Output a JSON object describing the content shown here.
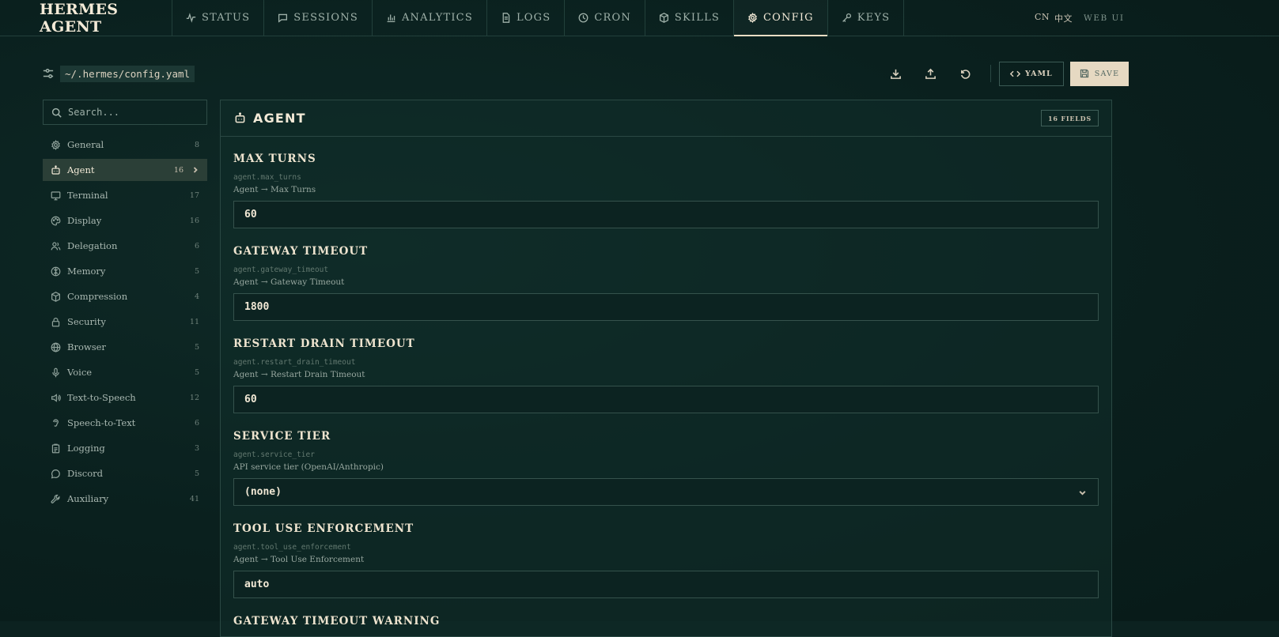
{
  "brand": "HERMES AGENT",
  "nav": [
    {
      "label": "STATUS",
      "icon": "activity-icon"
    },
    {
      "label": "SESSIONS",
      "icon": "chat-icon"
    },
    {
      "label": "ANALYTICS",
      "icon": "bar-chart-icon"
    },
    {
      "label": "LOGS",
      "icon": "file-icon"
    },
    {
      "label": "CRON",
      "icon": "clock-icon"
    },
    {
      "label": "SKILLS",
      "icon": "package-icon"
    },
    {
      "label": "CONFIG",
      "icon": "gear-icon",
      "active": true
    },
    {
      "label": "KEYS",
      "icon": "key-icon"
    }
  ],
  "header_right": {
    "lang_code": "CN",
    "lang_name": "中文",
    "webui": "WEB UI"
  },
  "toolbar": {
    "path": "~/.hermes/config.yaml",
    "yaml_label": "YAML",
    "save_label": "SAVE"
  },
  "search": {
    "placeholder": "Search..."
  },
  "sidebar": {
    "items": [
      {
        "label": "General",
        "count": "8"
      },
      {
        "label": "Agent",
        "count": "16",
        "active": true
      },
      {
        "label": "Terminal",
        "count": "17"
      },
      {
        "label": "Display",
        "count": "16"
      },
      {
        "label": "Delegation",
        "count": "6"
      },
      {
        "label": "Memory",
        "count": "5"
      },
      {
        "label": "Compression",
        "count": "4"
      },
      {
        "label": "Security",
        "count": "11"
      },
      {
        "label": "Browser",
        "count": "5"
      },
      {
        "label": "Voice",
        "count": "5"
      },
      {
        "label": "Text-to-Speech",
        "count": "12"
      },
      {
        "label": "Speech-to-Text",
        "count": "6"
      },
      {
        "label": "Logging",
        "count": "3"
      },
      {
        "label": "Discord",
        "count": "5"
      },
      {
        "label": "Auxiliary",
        "count": "41"
      }
    ]
  },
  "panel": {
    "title": "AGENT",
    "fields_badge": "16 FIELDS",
    "fields": [
      {
        "label": "MAX TURNS",
        "key": "agent.max_turns",
        "desc": "Agent → Max Turns",
        "value": "60"
      },
      {
        "label": "GATEWAY TIMEOUT",
        "key": "agent.gateway_timeout",
        "desc": "Agent → Gateway Timeout",
        "value": "1800"
      },
      {
        "label": "RESTART DRAIN TIMEOUT",
        "key": "agent.restart_drain_timeout",
        "desc": "Agent → Restart Drain Timeout",
        "value": "60"
      },
      {
        "label": "SERVICE TIER",
        "key": "agent.service_tier",
        "desc": "API service tier (OpenAI/Anthropic)",
        "value": "(none)",
        "type": "select"
      },
      {
        "label": "TOOL USE ENFORCEMENT",
        "key": "agent.tool_use_enforcement",
        "desc": "Agent → Tool Use Enforcement",
        "value": "auto"
      },
      {
        "label": "GATEWAY TIMEOUT WARNING"
      }
    ]
  }
}
